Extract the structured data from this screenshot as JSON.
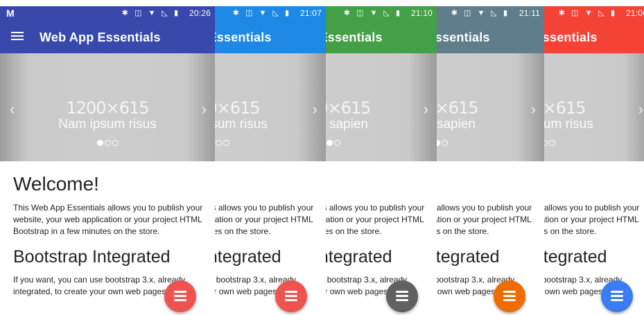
{
  "app_title": "Web App Essentials",
  "carrier_icon": "M",
  "status_icons": "✱ ◫ ▼ ◺ ▮",
  "placeholder_size": "1200×615",
  "intro": {
    "heading": "Welcome!",
    "text": "This Web App Essentials allows you to publish your website, your web application or your project HTML Bootstrap in a few minutes on the store."
  },
  "section": {
    "heading": "Bootstrap Integrated",
    "text": "If you want, you can use bootstrap 3.x, already integrated, to create your own web pages."
  },
  "icons": {
    "prev": "‹",
    "next": "›",
    "menu": "hamburger-menu-icon",
    "fab": "list-menu-icon"
  },
  "screens": [
    {
      "time": "20:26",
      "bar_color": "#3949ab",
      "fab_color": "#ef5350",
      "caption": "Nam ipsum risus",
      "active_dot": 0
    },
    {
      "time": "21:07",
      "bar_color": "#1e88e5",
      "fab_color": "#ef5350",
      "caption": "Nam ipsum risus",
      "active_dot": 0
    },
    {
      "time": "21:10",
      "bar_color": "#43a047",
      "fab_color": "#616161",
      "caption": "Ligula sapien",
      "active_dot": 1
    },
    {
      "time": "21:11",
      "bar_color": "#607d8b",
      "fab_color": "#ef6c00",
      "caption": "Ligula sapien",
      "active_dot": 1
    },
    {
      "time": "21:06",
      "bar_color": "#f44336",
      "fab_color": "#3b7df0",
      "caption": "Nam ipsum risus",
      "active_dot": 0
    }
  ]
}
